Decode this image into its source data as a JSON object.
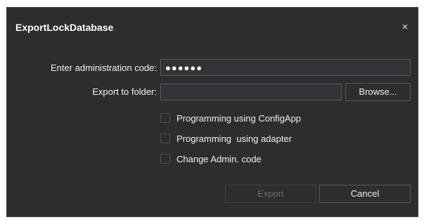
{
  "dialog": {
    "title": "ExportLockDatabase",
    "close_glyph": "×"
  },
  "form": {
    "admin_code_label": "Enter administration code:",
    "admin_code_value": "●●●●●●",
    "export_folder_label": "Export to folder:",
    "export_folder_value": "",
    "browse_label": "Browse..."
  },
  "options": [
    {
      "label": "Programming using ConfigApp",
      "checked": false
    },
    {
      "label": "Programming  using adapter",
      "checked": false
    },
    {
      "label": "Change Admin. code",
      "checked": false
    }
  ],
  "actions": {
    "export_label": "Export",
    "export_enabled": false,
    "cancel_label": "Cancel"
  },
  "colors": {
    "dialog_background": "#2d2d30",
    "page_background": "#ffffff",
    "border": "#5a5a5e",
    "text": "#f1f1f1",
    "disabled_text": "#6d6d70"
  }
}
